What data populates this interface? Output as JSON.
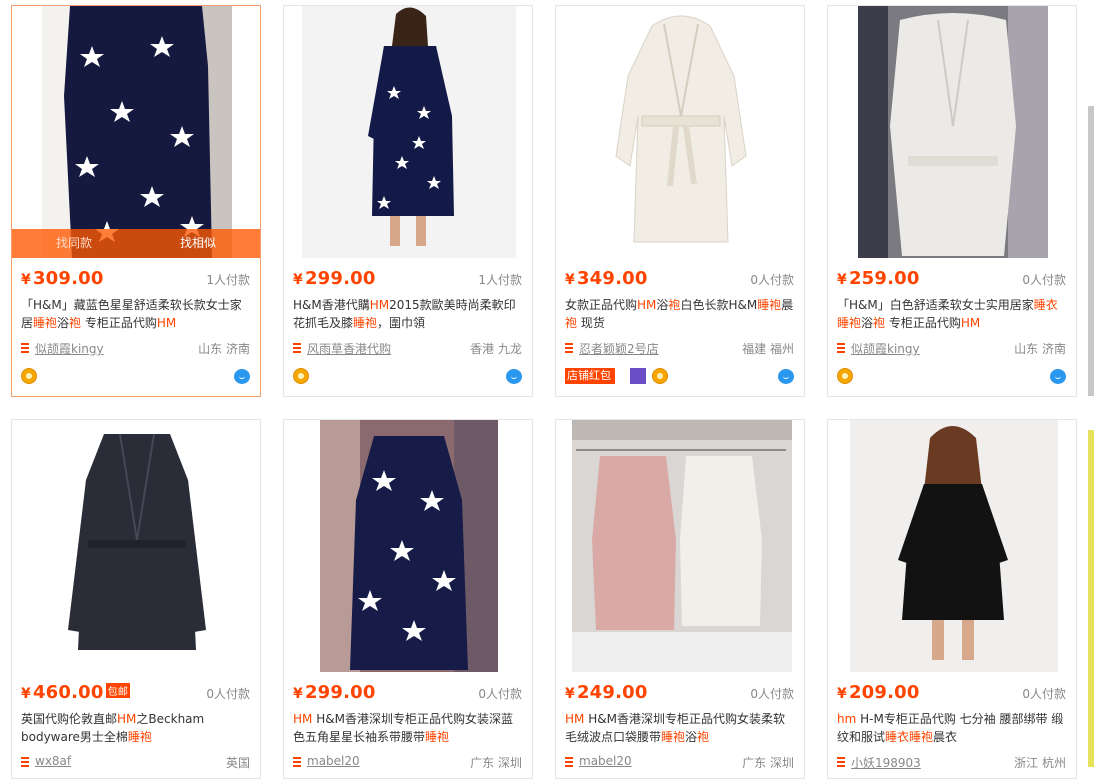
{
  "hover": {
    "same": "找同款",
    "similar": "找相似"
  },
  "products": [
    {
      "price": "309.00",
      "sold": "1人付款",
      "title": [
        {
          "t": "「H&M」藏蓝色星星舒适柔软长款女士家居"
        },
        {
          "t": "睡袍",
          "k": 1
        },
        {
          "t": "浴"
        },
        {
          "t": "袍",
          "k": 1
        },
        {
          "t": " 专柜正品代购"
        },
        {
          "t": "HM",
          "k": 1
        }
      ],
      "shop": "似颉霞kingy",
      "loc": "山东 济南",
      "badges": [
        "medal",
        "ww"
      ]
    },
    {
      "price": "299.00",
      "sold": "1人付款",
      "title": [
        {
          "t": "H&M香港代購"
        },
        {
          "t": "HM",
          "k": 1
        },
        {
          "t": "2015款歐美時尚柔軟印花抓毛及膝"
        },
        {
          "t": "睡袍",
          "k": 1
        },
        {
          "t": "，圍巾領"
        }
      ],
      "shop": "风雨草香港代购",
      "loc": "香港 九龙",
      "badges": [
        "medal",
        "ww"
      ]
    },
    {
      "price": "349.00",
      "sold": "0人付款",
      "title": [
        {
          "t": "女款正品代购"
        },
        {
          "t": "HM",
          "k": 1
        },
        {
          "t": "浴"
        },
        {
          "t": "袍",
          "k": 1
        },
        {
          "t": "白色长款H&M"
        },
        {
          "t": "睡袍",
          "k": 1
        },
        {
          "t": "晨"
        },
        {
          "t": "袍",
          "k": 1
        },
        {
          "t": " 现货"
        }
      ],
      "shop": "忍者颖颖2号店",
      "loc": "福建 福州",
      "badges": [
        "redpack",
        "moon",
        "medal2",
        "ww"
      ],
      "redpack": "店铺红包"
    },
    {
      "price": "259.00",
      "sold": "0人付款",
      "title": [
        {
          "t": "「H&M」白色舒适柔软女士实用居家"
        },
        {
          "t": "睡衣",
          "k": 1
        },
        {
          "t": ""
        },
        {
          "t": "睡袍",
          "k": 1
        },
        {
          "t": "浴"
        },
        {
          "t": "袍",
          "k": 1
        },
        {
          "t": " 专柜正品代购"
        },
        {
          "t": "HM",
          "k": 1
        }
      ],
      "shop": "似颉霞kingy",
      "loc": "山东 济南",
      "badges": [
        "medal",
        "ww"
      ]
    },
    {
      "price": "460.00",
      "sold": "0人付款",
      "pay_badge": "包邮",
      "title": [
        {
          "t": "英国代购伦敦直邮"
        },
        {
          "t": "HM",
          "k": 1
        },
        {
          "t": "之Beckham bodyware男士全棉"
        },
        {
          "t": "睡袍",
          "k": 1
        }
      ],
      "shop": "wx8af",
      "loc": "英国",
      "badges": []
    },
    {
      "price": "299.00",
      "sold": "0人付款",
      "title": [
        {
          "t": "HM",
          "k": 1
        },
        {
          "t": " H&M香港深圳专柜正品代购女装深蓝色五角星星长袖系带腰带"
        },
        {
          "t": "睡袍",
          "k": 1
        }
      ],
      "shop": "mabel20",
      "loc": "广东 深圳",
      "badges": []
    },
    {
      "price": "249.00",
      "sold": "0人付款",
      "title": [
        {
          "t": "HM",
          "k": 1
        },
        {
          "t": " H&M香港深圳专柜正品代购女装柔软毛绒波点口袋腰带"
        },
        {
          "t": "睡袍",
          "k": 1
        },
        {
          "t": "浴"
        },
        {
          "t": "袍",
          "k": 1
        }
      ],
      "shop": "mabel20",
      "loc": "广东 深圳",
      "badges": []
    },
    {
      "price": "209.00",
      "sold": "0人付款",
      "title": [
        {
          "t": "hm",
          "k": 1
        },
        {
          "t": " H-M专柜正品代购 七分袖 腰部绑带 缎纹和服试"
        },
        {
          "t": "睡衣",
          "k": 1
        },
        {
          "t": "睡袍",
          "k": 1
        },
        {
          "t": "晨衣"
        }
      ],
      "shop": "小妖198903",
      "loc": "浙江 杭州",
      "badges": []
    }
  ]
}
